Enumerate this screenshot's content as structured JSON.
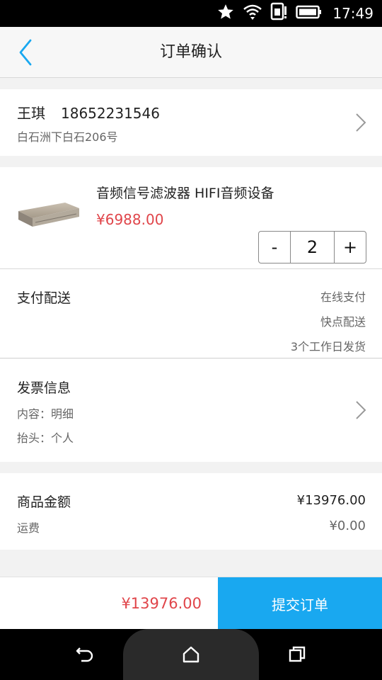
{
  "status_bar": {
    "time": "17:49",
    "icons": [
      "star-icon",
      "wifi-icon",
      "sim-icon",
      "battery-icon"
    ]
  },
  "nav": {
    "title": "订单确认",
    "back_icon": "chevron-left-icon"
  },
  "address": {
    "name": "王琪",
    "phone": "18652231546",
    "detail": "白石洲下白石206号"
  },
  "product": {
    "name": "音频信号滤波器 HIFI音频设备",
    "price": "¥6988.00",
    "quantity": "2",
    "decrement_label": "-",
    "increment_label": "+"
  },
  "payment": {
    "label": "支付配送",
    "method": "在线支付",
    "delivery": "快点配送",
    "eta": "3个工作日发货"
  },
  "invoice": {
    "label": "发票信息",
    "content": "内容：明细",
    "title": "抬头：个人"
  },
  "amount": {
    "goods_label": "商品金额",
    "goods_value": "¥13976.00",
    "shipping_label": "运费",
    "shipping_value": "¥0.00"
  },
  "bottom": {
    "total": "¥13976.00",
    "submit_label": "提交订单"
  },
  "colors": {
    "accent": "#19a8f0",
    "price_red": "#e0454a"
  }
}
